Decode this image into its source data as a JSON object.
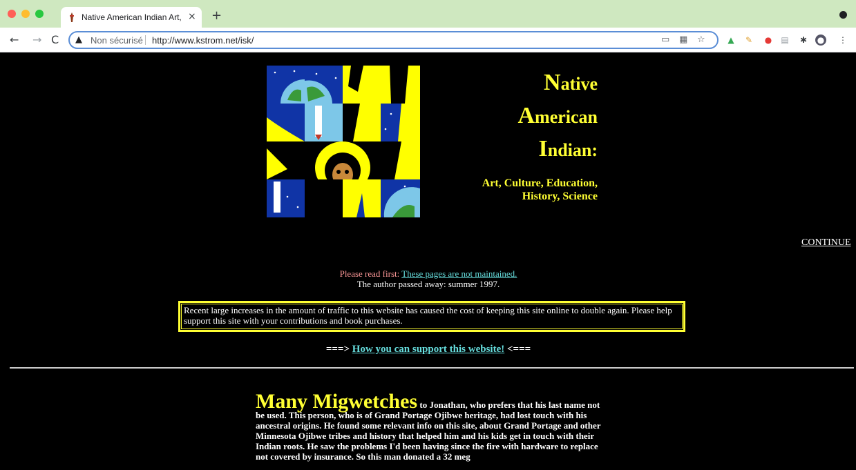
{
  "browser": {
    "tab_title": "Native American Indian Art, Cul",
    "tab_close": "×",
    "new_tab": "+",
    "security_label": "Non sécurisé",
    "url": "http://www.kstrom.net/isk/",
    "nav": {
      "back": "←",
      "forward": "→",
      "reload": "C"
    }
  },
  "page": {
    "title_lines": [
      {
        "cap": "N",
        "rest": "ative"
      },
      {
        "cap": "A",
        "rest": "merican"
      },
      {
        "cap": "I",
        "rest": "ndian:"
      }
    ],
    "subtitle_line1": "Art, Culture, Education,",
    "subtitle_line2": "History, Science",
    "continue_link": "CONTINUE",
    "notice_lead": "Please read first:",
    "notice_link": "These pages are not maintained.",
    "notice_line2": "The author passed away: summer 1997.",
    "cost_notice": "Recent large increases in the amount of traffic to this website has caused the cost of keeping this site online to double again. Please help support this site with your contributions and book purchases.",
    "support_prefix": "===>",
    "support_link": "How you can support this website!",
    "support_suffix": "<===",
    "thanks_heading": "Many Migwetches",
    "thanks_body": "to Jonathan, who prefers that his last name not be used. This person, who is of Grand Portage Ojibwe heritage, had lost touch with his ancestral origins. He found some relevant info on this site, about Grand Portage and other Minnesota Ojibwe tribes and history that helped him and his kids get in touch with their Indian roots. He saw the problems I'd been having since the fire with hardware to replace not covered by insurance. So this man donated a 32 meg"
  },
  "colors": {
    "title_yellow": "#ffff33",
    "link_cyan": "#66dddd",
    "notice_pink": "#ff9999",
    "tabbar_green": "#cfe8c0"
  }
}
